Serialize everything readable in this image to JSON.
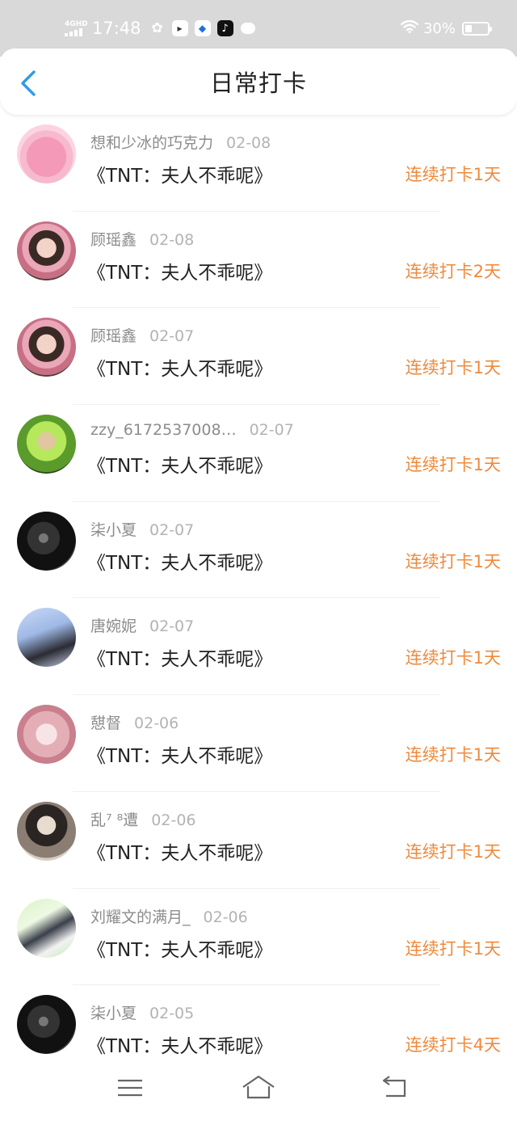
{
  "status_bar": {
    "network": "4GHD",
    "time": "17:48",
    "battery_text": "30%",
    "battery_level": 0.3,
    "app_icons": [
      "wechat-icon",
      "note-app-icon",
      "blue-app-icon",
      "tiktok-icon",
      "message-bubble-icon"
    ]
  },
  "header": {
    "title": "日常打卡"
  },
  "checkins": [
    {
      "user": "想和少冰的巧克力",
      "date": "02-08",
      "book": "《TNT：夫人不乖呢》",
      "streak": "连续打卡1天",
      "avatar": "pink"
    },
    {
      "user": "顾瑶鑫",
      "date": "02-08",
      "book": "《TNT：夫人不乖呢》",
      "streak": "连续打卡2天",
      "avatar": "girl"
    },
    {
      "user": "顾瑶鑫",
      "date": "02-07",
      "book": "《TNT：夫人不乖呢》",
      "streak": "连续打卡1天",
      "avatar": "girl"
    },
    {
      "user": "zzy_6172537008…",
      "date": "02-07",
      "book": "《TNT：夫人不乖呢》",
      "streak": "连续打卡1天",
      "avatar": "green"
    },
    {
      "user": "柒小夏",
      "date": "02-07",
      "book": "《TNT：夫人不乖呢》",
      "streak": "连续打卡1天",
      "avatar": "dark"
    },
    {
      "user": "唐婉妮",
      "date": "02-07",
      "book": "《TNT：夫人不乖呢》",
      "streak": "连续打卡1天",
      "avatar": "sky"
    },
    {
      "user": "憇督",
      "date": "02-06",
      "book": "《TNT：夫人不乖呢》",
      "streak": "连续打卡1天",
      "avatar": "rose"
    },
    {
      "user": "乱⁷ ⁸遭",
      "date": "02-06",
      "book": "《TNT：夫人不乖呢》",
      "streak": "连续打卡1天",
      "avatar": "mono"
    },
    {
      "user": "刘耀文的满月_",
      "date": "02-06",
      "book": "《TNT：夫人不乖呢》",
      "streak": "连续打卡1天",
      "avatar": "mint"
    },
    {
      "user": "柒小夏",
      "date": "02-05",
      "book": "《TNT：夫人不乖呢》",
      "streak": "连续打卡4天",
      "avatar": "dark"
    }
  ],
  "colors": {
    "accent": "#ef8a3c",
    "back_arrow": "#2f9be8",
    "status_bar_bg": "#d9d9d9"
  },
  "nav_bar": {
    "icons": [
      "menu-icon",
      "home-icon",
      "back-icon"
    ]
  }
}
